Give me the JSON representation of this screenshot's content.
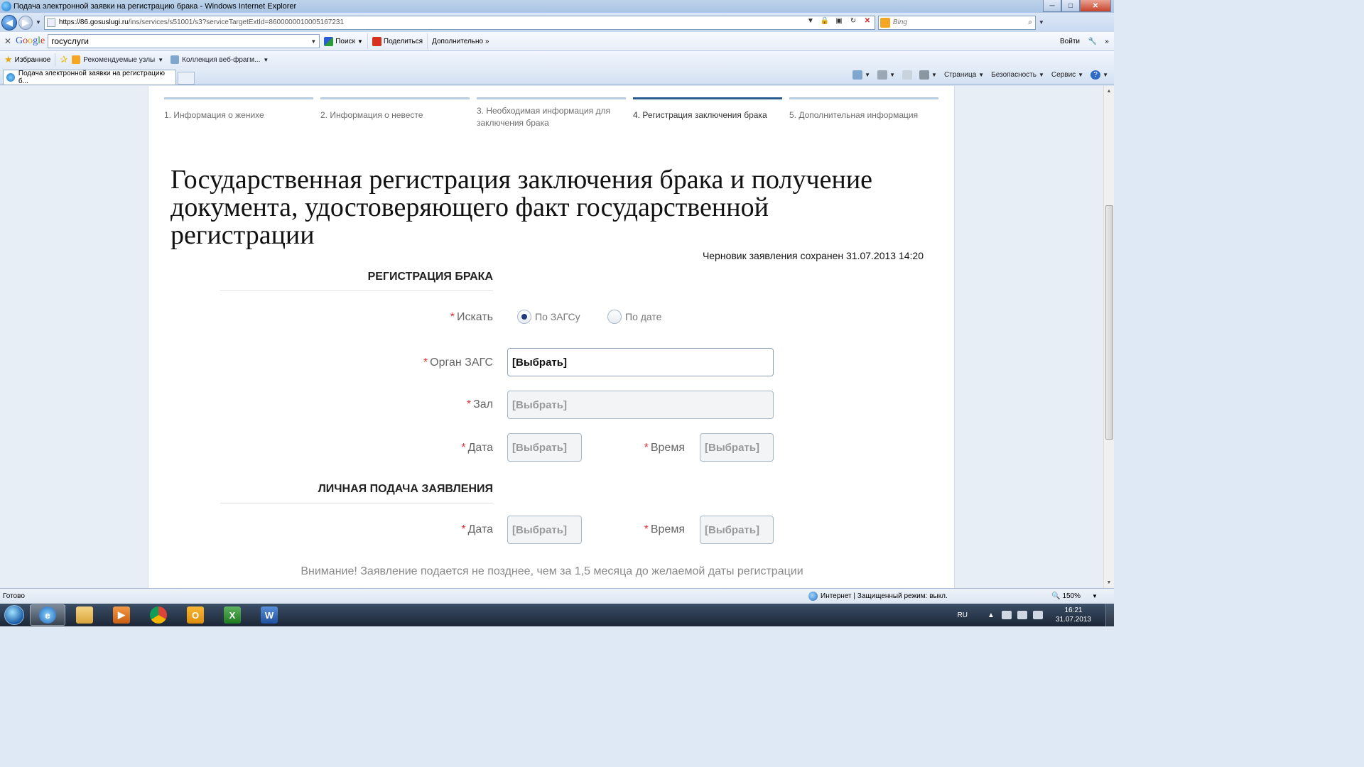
{
  "window": {
    "title": "Подача электронной заявки на регистрацию брака - Windows Internet Explorer"
  },
  "addressbar": {
    "url_domain": "https://86.gosuslugi.ru",
    "url_path": "/ins/services/s51001/s3?serviceTargetExtId=8600000010005167231",
    "search_placeholder": "Bing"
  },
  "google_toolbar": {
    "query": "госуслуги",
    "search_label": "Поиск",
    "share_label": "Поделиться",
    "more_label": "Дополнительно »",
    "login_label": "Войти"
  },
  "favorites": {
    "label": "Избранное",
    "items": [
      {
        "label": "Рекомендуемые узлы"
      },
      {
        "label": "Коллекция веб-фрагм..."
      }
    ]
  },
  "tab": {
    "label": "Подача электронной заявки на регистрацию б..."
  },
  "commandbar": {
    "page_label": "Страница",
    "safety_label": "Безопасность",
    "tools_label": "Сервис"
  },
  "steps": [
    {
      "label": "1. Информация о женихе"
    },
    {
      "label": "2. Информация о невесте"
    },
    {
      "label": "3. Необходимая информация для заключения брака"
    },
    {
      "label": "4. Регистрация заключения брака",
      "active": true
    },
    {
      "label": "5. Дополнительная информация"
    }
  ],
  "page": {
    "title": "Государственная регистрация заключения брака и получение документа, удостоверяющего факт государственной регистрации",
    "draft_note": "Черновик заявления сохранен 31.07.2013 14:20"
  },
  "registration": {
    "section_title": "РЕГИСТРАЦИЯ БРАКА",
    "search_label": "Искать",
    "radio_zags": "По ЗАГСу",
    "radio_date": "По дате",
    "radio_selected": "По ЗАГСу",
    "organ_label": "Орган ЗАГС",
    "organ_value": "[Выбрать]",
    "hall_label": "Зал",
    "hall_value": "[Выбрать]",
    "date_label": "Дата",
    "date_value": "[Выбрать]",
    "time_label": "Время",
    "time_value": "[Выбрать]",
    "required_mark": "*"
  },
  "personal_submission": {
    "section_title": "ЛИЧНАЯ ПОДАЧА ЗАЯВЛЕНИЯ",
    "date_label": "Дата",
    "date_value": "[Выбрать]",
    "time_label": "Время",
    "time_value": "[Выбрать]"
  },
  "notice": "Внимание! Заявление подается не позднее, чем за 1,5 месяца до желаемой даты регистрации",
  "statusbar": {
    "status": "Готово",
    "zone": "Интернет | Защищенный режим: выкл.",
    "zoom": "150%"
  },
  "taskbar": {
    "lang": "RU",
    "time": "16:21",
    "date": "31.07.2013",
    "apps": [
      "internet-explorer",
      "windows-explorer",
      "media-player",
      "chrome",
      "outlook",
      "excel",
      "word"
    ]
  }
}
